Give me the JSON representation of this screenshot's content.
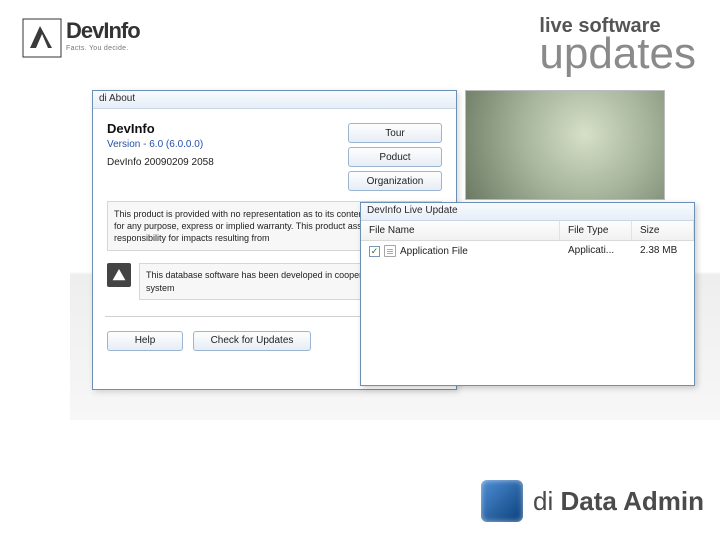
{
  "brand": {
    "name": "DevInfo",
    "tagline": "Facts. You decide."
  },
  "title": {
    "small": "live software",
    "big": "updates"
  },
  "about": {
    "window_title": "di About",
    "product": "DevInfo",
    "version": "Version - 6.0 (6.0.0.0)",
    "build": "DevInfo  20090209  2058",
    "buttons": {
      "tour": "Tour",
      "product": "Poduct",
      "organization": "Organization"
    },
    "disclaimer": "This product is provided with no representation as to its content and its suitability for any purpose, express or implied warranty. This product assumes no responsibility for impacts resulting from",
    "db_note": "This database software has been developed in cooperation of the UN system",
    "help": "Help",
    "check_updates": "Check for Updates"
  },
  "update": {
    "window_title": "DevInfo Live Update",
    "headers": {
      "file_name": "File Name",
      "file_type": "File Type",
      "size": "Size"
    },
    "rows": [
      {
        "checked": true,
        "name": "Application File",
        "type": "Applicati...",
        "size": "2.38 MB"
      }
    ]
  },
  "footer": {
    "di": "di",
    "rest": " Data Admin"
  }
}
